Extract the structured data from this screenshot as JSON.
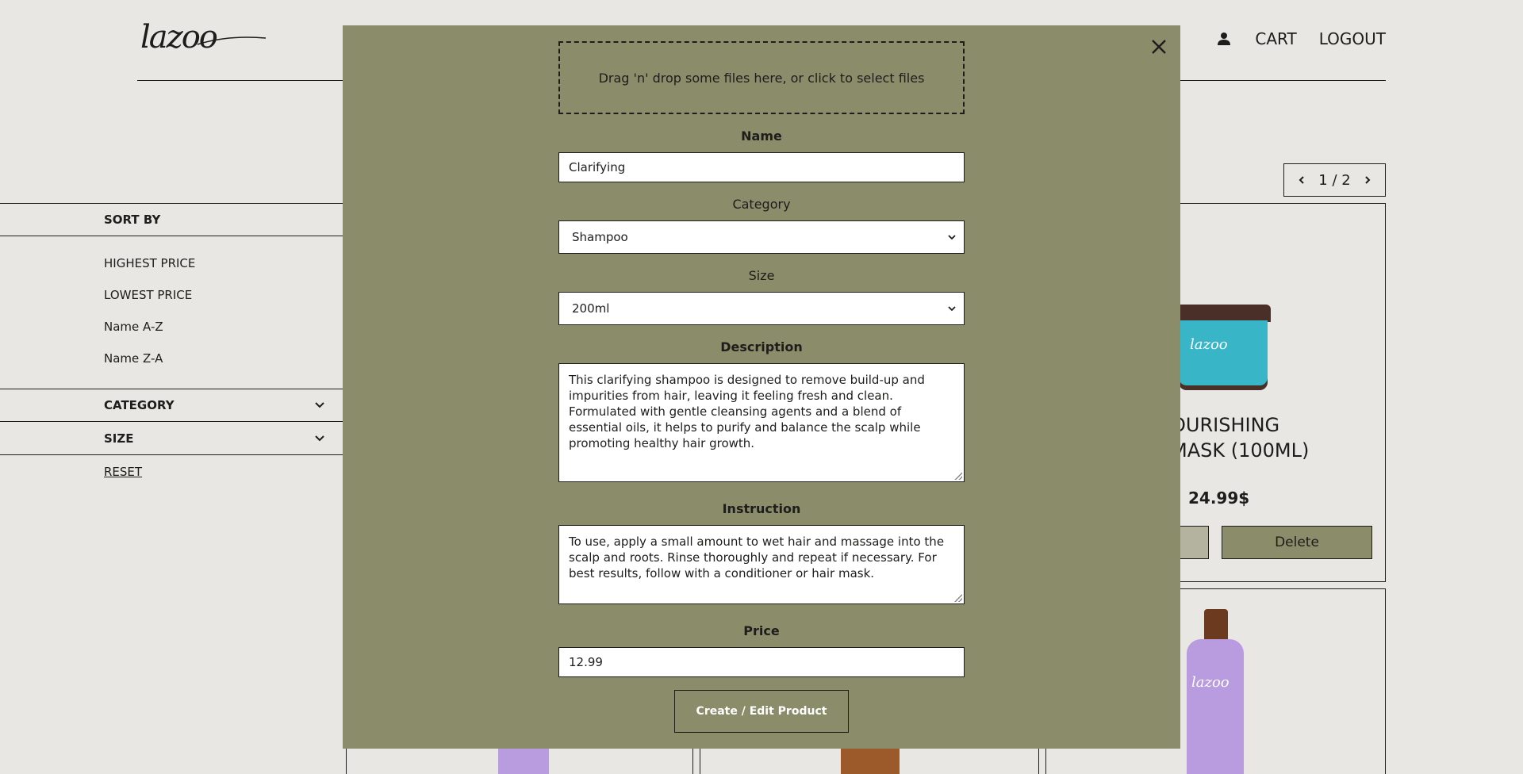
{
  "header": {
    "logo_text": "lazoo",
    "nav": {
      "cart": "CART",
      "logout": "LOGOUT"
    }
  },
  "pager": {
    "text": "1 / 2"
  },
  "sidebar": {
    "sort_by": "SORT BY",
    "sort_options": [
      "HIGHEST PRICE",
      "LOWEST PRICE",
      "Name A-Z",
      "Name Z-A"
    ],
    "category": "CATEGORY",
    "size": "SIZE",
    "reset": "RESET"
  },
  "products": {
    "card1": {
      "title_line1": "OURISHING",
      "title_line2": "MASK (100ML)",
      "price": "24.99$",
      "delete": "Delete",
      "jar_brand": "lazoo"
    },
    "card2": {
      "bottle_brand": "lazoo"
    }
  },
  "modal": {
    "dropzone": "Drag 'n' drop some files here, or click to select files",
    "name_label": "Name",
    "name_value": "Clarifying",
    "category_label": "Category",
    "category_value": "Shampoo",
    "size_label": "Size",
    "size_value": "200ml",
    "description_label": "Description",
    "description_value": "This clarifying shampoo is designed to remove build-up and impurities from hair, leaving it feeling fresh and clean. Formulated with gentle cleansing agents and a blend of essential oils, it helps to purify and balance the scalp while promoting healthy hair growth.",
    "instruction_label": "Instruction",
    "instruction_value": "To use, apply a small amount to wet hair and massage into the scalp and roots. Rinse thoroughly and repeat if necessary. For best results, follow with a conditioner or hair mask.",
    "price_label": "Price",
    "price_value": "12.99",
    "submit": "Create / Edit Product"
  },
  "icons": {
    "close": "close-icon",
    "user": "user-icon",
    "chevron": "chevron-down-icon"
  }
}
